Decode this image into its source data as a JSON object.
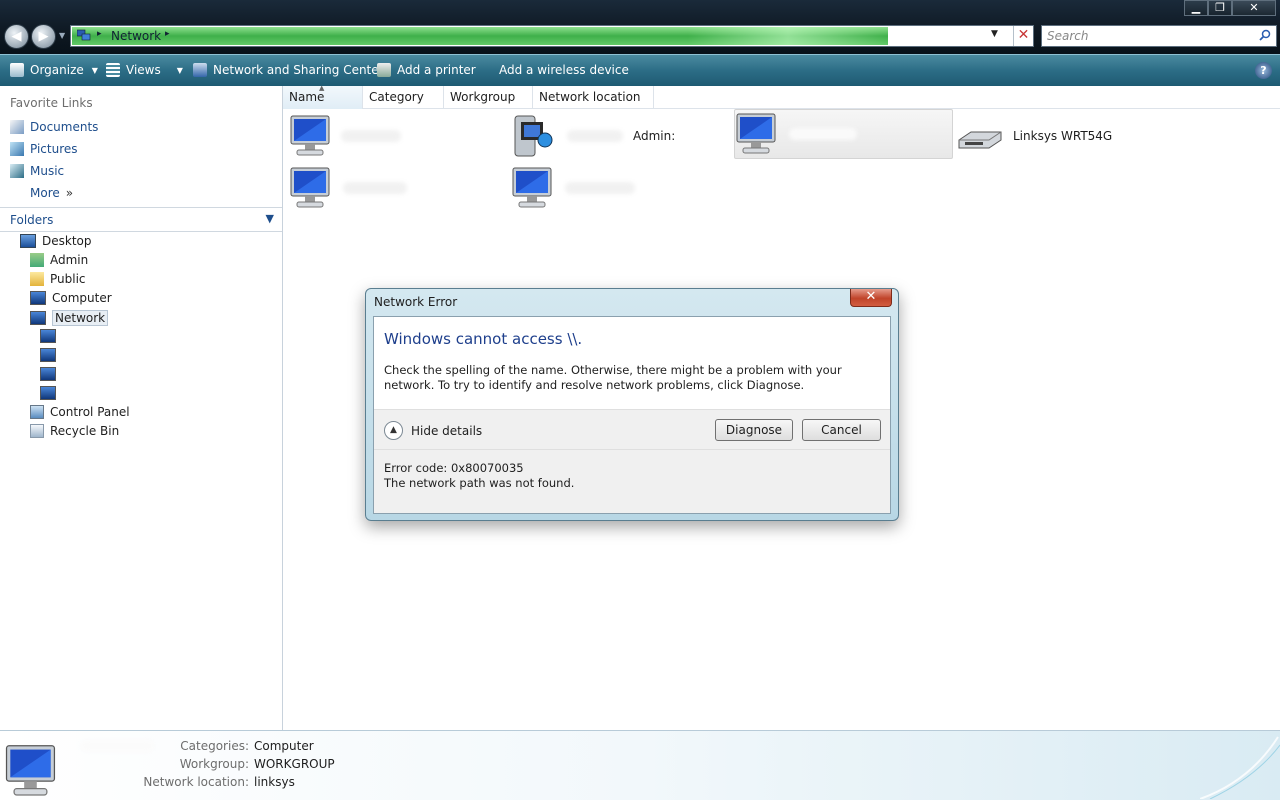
{
  "window": {
    "address_crumb": "Network",
    "search_placeholder": "Search",
    "minimize": "▁",
    "maximize": "❐",
    "close": "✕"
  },
  "toolbar": {
    "organize": "Organize",
    "views": "Views",
    "network_center": "Network and Sharing Center",
    "add_printer": "Add a printer",
    "add_wireless": "Add a wireless device",
    "help": "?"
  },
  "sidebar": {
    "favorite_links_title": "Favorite Links",
    "favorites": [
      "Documents",
      "Pictures",
      "Music"
    ],
    "more": "More",
    "folders_title": "Folders",
    "tree": {
      "desktop": "Desktop",
      "admin": "Admin",
      "public": "Public",
      "computer": "Computer",
      "network": "Network",
      "control_panel": "Control Panel",
      "recycle_bin": "Recycle Bin"
    }
  },
  "columns": [
    "Name",
    "Category",
    "Workgroup",
    "Network location"
  ],
  "items": {
    "media_label": "Admin:",
    "router_label": "Linksys WRT54G"
  },
  "dialog": {
    "title": "Network Error",
    "close": "✕",
    "heading": "Windows cannot access \\\\.",
    "message": "Check the spelling of the name. Otherwise, there might be a problem with your network. To try to identify and resolve network problems, click Diagnose.",
    "hide_details": "Hide details",
    "diagnose": "Diagnose",
    "cancel": "Cancel",
    "error_code": "Error code: 0x80070035",
    "error_text": "The network path was not found."
  },
  "details": {
    "categories_label": "Categories:",
    "categories_value": "Computer",
    "workgroup_label": "Workgroup:",
    "workgroup_value": "WORKGROUP",
    "location_label": "Network location:",
    "location_value": "linksys"
  },
  "colors": {
    "toolbar": "#2c6d86",
    "link": "#1e4e8c",
    "dialog_heading": "#1e3f8c",
    "progress": "#3fb04a"
  }
}
